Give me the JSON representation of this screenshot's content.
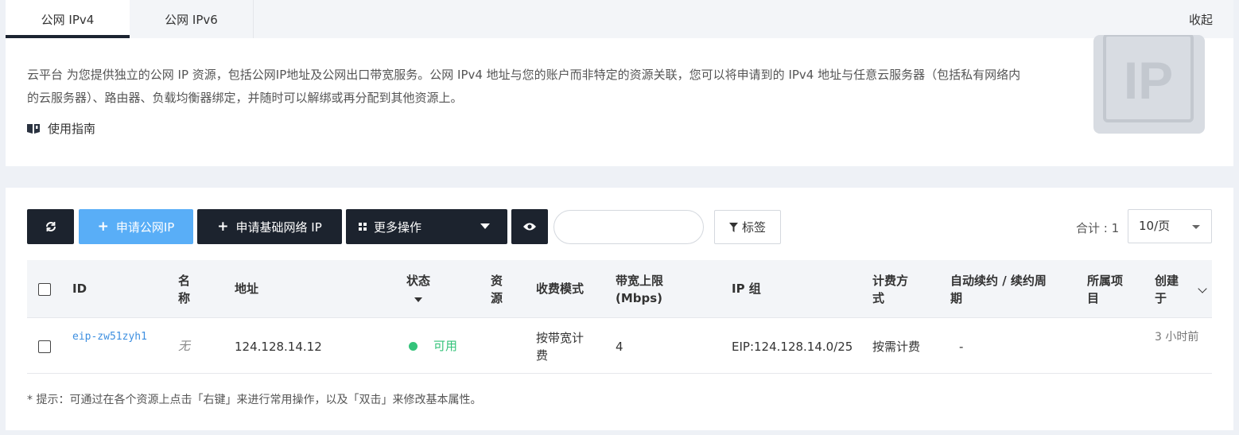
{
  "tabs": [
    {
      "label": "公网 IPv4",
      "active": true
    },
    {
      "label": "公网 IPv6",
      "active": false
    }
  ],
  "collapse_label": "收起",
  "info": {
    "description": "云平台 为您提供独立的公网 IP 资源，包括公网IP地址及公网出口带宽服务。公网 IPv4 地址与您的账户而非特定的资源关联，您可以将申请到的 IPv4 地址与任意云服务器（包括私有网络内的云服务器）、路由器、负载均衡器绑定，并随时可以解绑或再分配到其他资源上。",
    "guide_label": "使用指南",
    "logo_text": "IP"
  },
  "toolbar": {
    "refresh_icon": "refresh-icon",
    "apply_label": "申请公网IP",
    "basic_label": "申请基础网络 IP",
    "more_label": "更多操作",
    "eye_icon": "eye-icon",
    "search_placeholder": "",
    "tag_label": "标签",
    "total_label": "合计 : 1",
    "page_size": "10/页"
  },
  "table": {
    "columns": {
      "id": "ID",
      "name": "名称",
      "address": "地址",
      "status": "状态",
      "resource": "资源",
      "charge_mode": "收费模式",
      "bandwidth": "带宽上限 (Mbps)",
      "ip_group": "IP 组",
      "billing": "计费方式",
      "renew": "自动续约 / 续约周期",
      "project": "所属项目",
      "created": "创建于"
    },
    "rows": [
      {
        "id": "eip-zw51zyh1",
        "name": "无",
        "address": "124.128.14.12",
        "status": "可用",
        "resource": "",
        "charge_mode": "按带宽计费",
        "bandwidth": "4",
        "ip_group": "EIP:124.128.14.0/25",
        "billing": "按需计费",
        "renew": "-",
        "project": "",
        "created": "3 小时前"
      }
    ]
  },
  "hint": "* 提示：可通过在各个资源上点击「右键」来进行常用操作，以及「双击」来修改基本属性。",
  "colors": {
    "primary_dark": "#1c232e",
    "primary_blue": "#59aef7",
    "status_green": "#34c37a",
    "link_blue": "#3d8fe0"
  }
}
